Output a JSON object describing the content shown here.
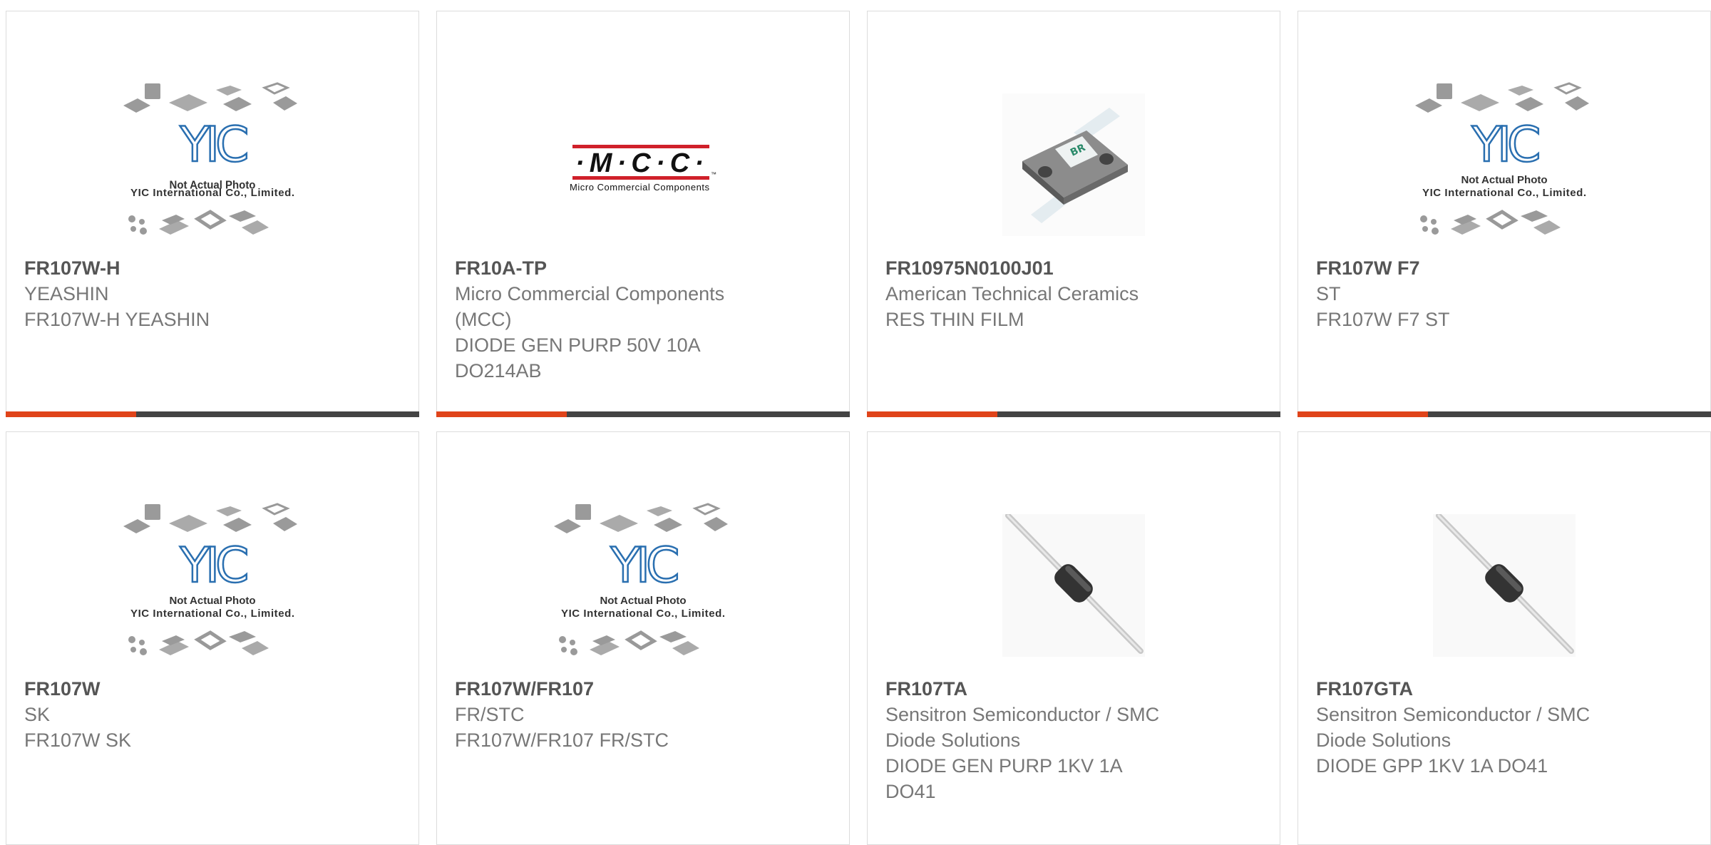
{
  "colors": {
    "accent": "#e0441a",
    "bar": "#444444",
    "yic_blue": "#2a6fb0",
    "mcc_red": "#d0202a"
  },
  "products": [
    {
      "part": "FR107W-H",
      "lines": [
        "YEASHIN",
        "FR107W-H YEASHIN"
      ],
      "image": "yic-placeholder",
      "img_text": {
        "brand": "YIC",
        "note1": "Not Actual Photo",
        "note2": "YIC International Co., Limited."
      }
    },
    {
      "part": "FR10A-TP",
      "lines": [
        "Micro Commercial Components",
        "(MCC)",
        "DIODE GEN PURP 50V 10A",
        "DO214AB"
      ],
      "image": "mcc-logo",
      "img_text": {
        "logo": "·M·C·C·",
        "tm": "™",
        "sub": "Micro Commercial Components"
      }
    },
    {
      "part": "FR10975N0100J01",
      "lines": [
        "American Technical Ceramics",
        "RES THIN FILM"
      ],
      "image": "thin-film-resistor"
    },
    {
      "part": "FR107W F7",
      "lines": [
        "ST",
        "FR107W F7 ST"
      ],
      "image": "yic-placeholder",
      "img_text": {
        "brand": "YIC",
        "note1": "Not Actual Photo",
        "note2": "YIC International Co., Limited."
      }
    },
    {
      "part": "FR107W",
      "lines": [
        "SK",
        "FR107W SK"
      ],
      "image": "yic-placeholder",
      "img_text": {
        "brand": "YIC",
        "note1": "Not Actual Photo",
        "note2": "YIC International Co., Limited."
      }
    },
    {
      "part": "FR107W/FR107",
      "lines": [
        "FR/STC",
        "FR107W/FR107 FR/STC"
      ],
      "image": "yic-placeholder",
      "img_text": {
        "brand": "YIC",
        "note1": "Not Actual Photo",
        "note2": "YIC International Co., Limited."
      }
    },
    {
      "part": "FR107TA",
      "lines": [
        "Sensitron Semiconductor / SMC",
        "Diode Solutions",
        "DIODE GEN PURP 1KV 1A",
        "DO41"
      ],
      "image": "axial-diode"
    },
    {
      "part": "FR107GTA",
      "lines": [
        "Sensitron Semiconductor / SMC",
        "Diode Solutions",
        "DIODE GPP 1KV 1A DO41"
      ],
      "image": "axial-diode"
    }
  ]
}
